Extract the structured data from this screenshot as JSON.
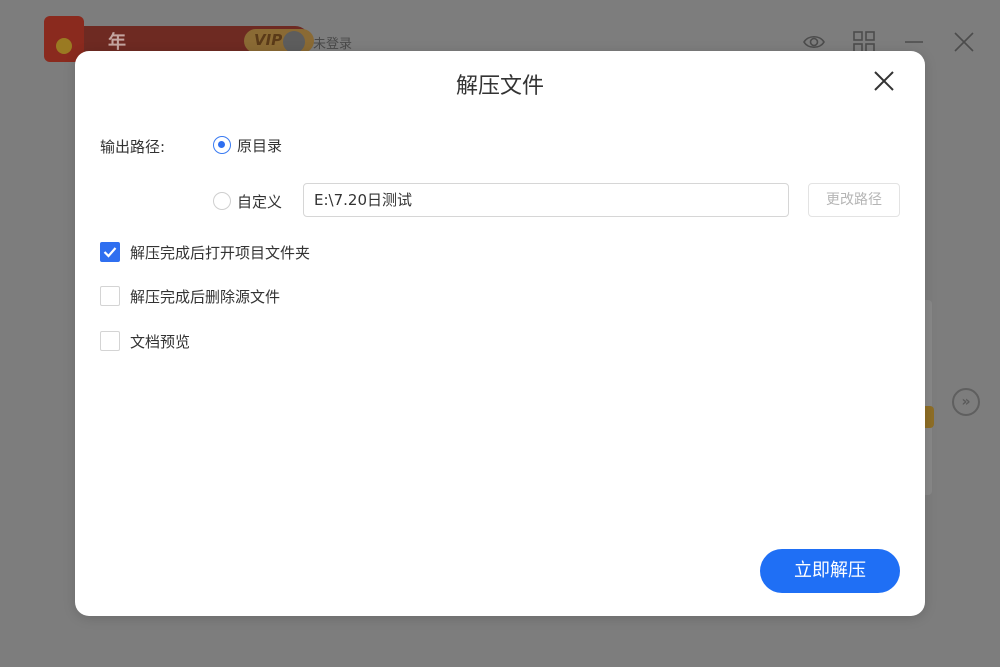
{
  "background": {
    "promo_label": "年中特惠",
    "vip_label": "VIP",
    "vip_arrow": "›",
    "login_label": "未登录",
    "side_arrow": "»",
    "icons": [
      "red-envelope-icon",
      "user-avatar-icon",
      "skin-icon",
      "grid-icon",
      "minimize-icon",
      "close-icon"
    ]
  },
  "dialog": {
    "title": "解压文件",
    "output_path_label": "输出路径:",
    "radio_original": "原目录",
    "radio_custom": "自定义",
    "custom_path_value": "E:\\7.20日测试",
    "change_path_button": "更改路径",
    "checkbox_open_folder": "解压完成后打开项目文件夹",
    "checkbox_delete_source": "解压完成后删除源文件",
    "checkbox_preview": "文档预览",
    "extract_button": "立即解压",
    "state": {
      "selected_output": "原目录",
      "open_folder_checked": true,
      "delete_source_checked": false,
      "preview_checked": false
    },
    "accent_color": "#1f6ff5"
  }
}
